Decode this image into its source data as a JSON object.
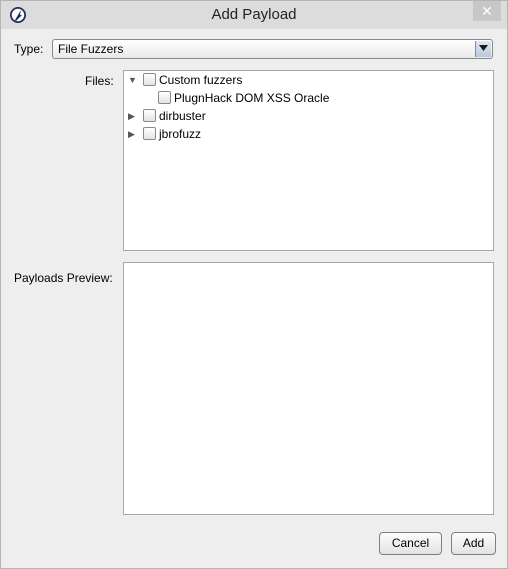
{
  "window": {
    "title": "Add Payload",
    "close_glyph": "✕"
  },
  "type_field": {
    "label": "Type:",
    "value": "File Fuzzers"
  },
  "files": {
    "label": "Files:",
    "tree": [
      {
        "label": "Custom fuzzers",
        "expanded": true,
        "checked": false
      },
      {
        "label": "PlugnHack DOM XSS Oracle",
        "checked": false
      },
      {
        "label": "dirbuster",
        "expanded": false,
        "checked": false
      },
      {
        "label": "jbrofuzz",
        "expanded": false,
        "checked": false
      }
    ],
    "expanded_glyph": "▼",
    "collapsed_glyph": "▶"
  },
  "preview": {
    "label": "Payloads Preview:"
  },
  "buttons": {
    "cancel": "Cancel",
    "add": "Add"
  }
}
